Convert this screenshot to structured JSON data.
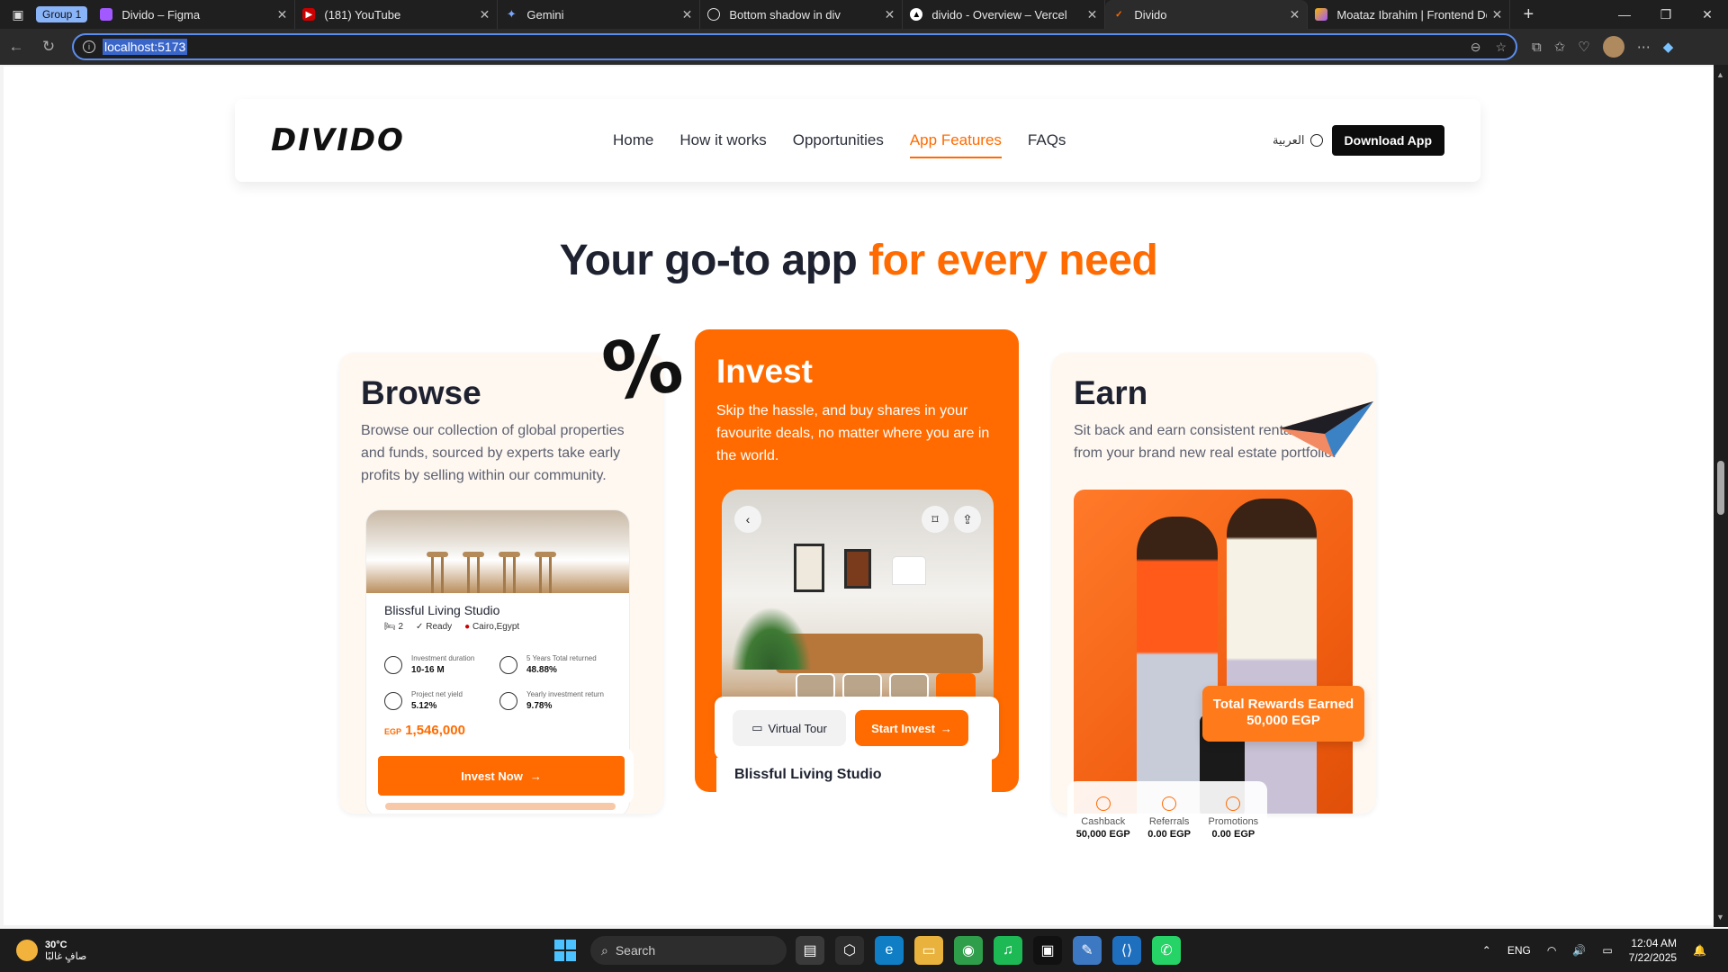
{
  "browser": {
    "group_label": "Group 1",
    "tabs": [
      {
        "title": "Divido – Figma",
        "color": "#a259ff"
      },
      {
        "title": "(181) YouTube",
        "color": "#ff0000"
      },
      {
        "title": "Gemini",
        "color": "#4f7bf7"
      },
      {
        "title": "Bottom shadow in div",
        "color": "#888888"
      },
      {
        "title": "divido - Overview – Vercel",
        "color": "#000000"
      },
      {
        "title": "Divido",
        "color": "#ff6b00"
      },
      {
        "title": "Moataz Ibrahim | Frontend Dev",
        "color": "#f5b400"
      }
    ],
    "url": "localhost:5173"
  },
  "site": {
    "logo": "DIVIDO",
    "nav": [
      "Home",
      "How it works",
      "Opportunities",
      "App Features",
      "FAQs"
    ],
    "active_nav": "App Features",
    "lang_label": "العربية",
    "download_label": "Download App",
    "accent": "#ff6b00"
  },
  "section": {
    "heading_main": "Your go-to app ",
    "heading_accent": "for every need"
  },
  "cards": {
    "browse": {
      "title": "Browse",
      "desc": "Browse our collection of global properties and funds, sourced by experts take early profits by selling within our community.",
      "property": {
        "name": "Blissful Living Studio",
        "beds": "2",
        "status": "Ready",
        "location": "Cairo,Egypt",
        "stats": [
          {
            "label": "Investment duration",
            "value": "10-16 M"
          },
          {
            "label": "5 Years Total returned",
            "value": "48.88%"
          },
          {
            "label": "Project net yield",
            "value": "5.12%"
          },
          {
            "label": "Yearly investment return",
            "value": "9.78%"
          }
        ],
        "currency": "EGP",
        "price": "1,546,000"
      },
      "button": "Invest Now"
    },
    "invest": {
      "title": "Invest",
      "desc": "Skip the hassle, and buy shares in your favourite deals, no matter where you are in the world.",
      "virtual_tour": "Virtual Tour",
      "start_invest": "Start Invest",
      "property_name": "Blissful Living Studio"
    },
    "earn": {
      "title": "Earn",
      "desc": "Sit back and earn consistent rental income from your brand new real estate portfolio.",
      "rewards_label": "Total Rewards Earned",
      "rewards_value": "50,000 EGP",
      "stats": [
        {
          "label": "Cashback",
          "value": "50,000 EGP"
        },
        {
          "label": "Referrals",
          "value": "0.00 EGP"
        },
        {
          "label": "Promotions",
          "value": "0.00 EGP"
        }
      ]
    }
  },
  "taskbar": {
    "temp": "30°C",
    "weather": "صافٍ غالبًا",
    "search": "Search",
    "lang": "ENG",
    "time": "12:04 AM",
    "date": "7/22/2025"
  }
}
